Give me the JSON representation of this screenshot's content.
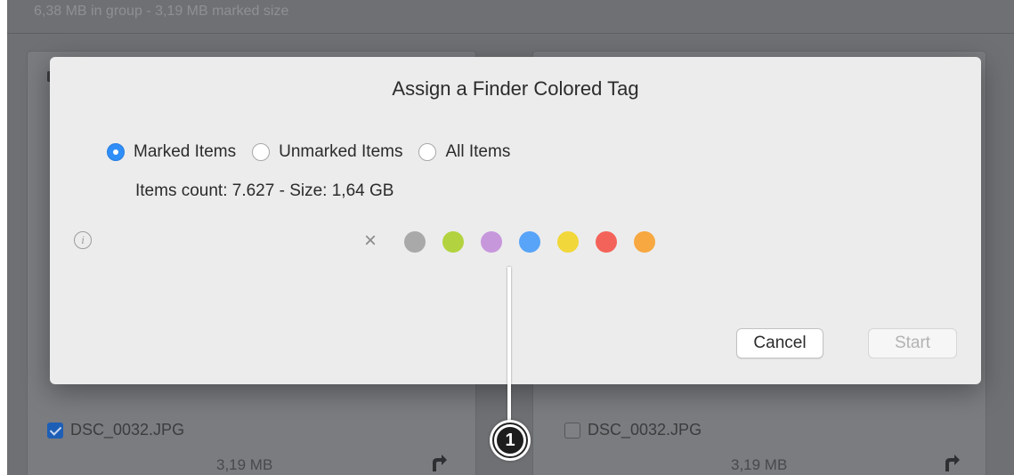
{
  "background": {
    "header_text": "6,38 MB in group - 3,19 MB marked size",
    "left_panel": {
      "file_name": "DSC_0032.JPG",
      "size": "3,19 MB",
      "checked": true
    },
    "right_panel": {
      "file_name": "DSC_0032.JPG",
      "size": "3,19 MB",
      "checked": false
    }
  },
  "dialog": {
    "title": "Assign a Finder Colored Tag",
    "options": [
      {
        "label": "Marked Items",
        "selected": true
      },
      {
        "label": "Unmarked Items",
        "selected": false
      },
      {
        "label": "All Items",
        "selected": false
      }
    ],
    "items_count": "Items count: 7.627 - Size: 1,64 GB",
    "info_icon": "i",
    "clear_tag_glyph": "×",
    "tags": [
      {
        "name": "gray",
        "color": "#a9a9a9"
      },
      {
        "name": "green",
        "color": "#b2d33f"
      },
      {
        "name": "purple",
        "color": "#c797dc"
      },
      {
        "name": "blue",
        "color": "#57a4f8"
      },
      {
        "name": "yellow",
        "color": "#f1d73a"
      },
      {
        "name": "red",
        "color": "#f4635a"
      },
      {
        "name": "orange",
        "color": "#f7a840"
      }
    ],
    "cancel_label": "Cancel",
    "start_label": "Start"
  },
  "callout": {
    "number": "1"
  }
}
